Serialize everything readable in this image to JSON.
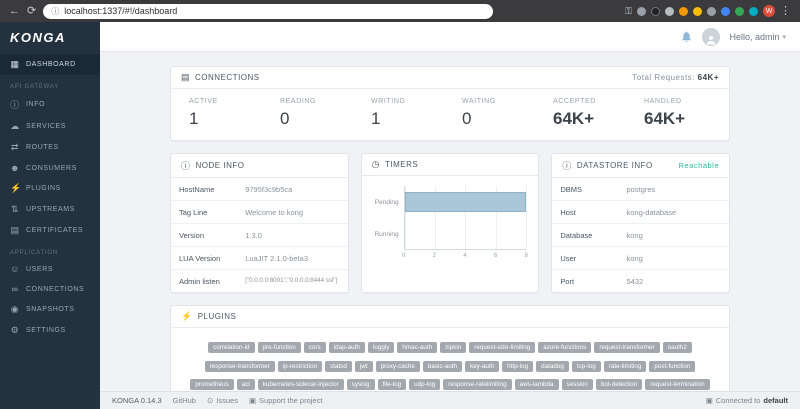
{
  "browser": {
    "url": "localhost:1337/#!/dashboard",
    "profile_initial": "W"
  },
  "icons": {
    "back": "←",
    "forward": "→",
    "reload": "⟳",
    "url_info": "ⓘ",
    "menu": "⋮",
    "grid": "▦",
    "info": "ⓘ",
    "cloud": "☁",
    "routes": "⇄",
    "consumers": "☻",
    "plug": "⚡",
    "upstreams": "⇅",
    "certificates": "▤",
    "user": "☺",
    "link": "∞",
    "camera": "◉",
    "gear": "⚙",
    "clock": "◷",
    "server": "▤",
    "caret": "▾",
    "issues": "⊙",
    "monitor": "▣"
  },
  "sidebar": {
    "logo": "KONGA",
    "sections": {
      "gateway": "API GATEWAY",
      "application": "APPLICATION"
    },
    "items": [
      {
        "label": "DASHBOARD"
      },
      {
        "label": "INFO"
      },
      {
        "label": "SERVICES"
      },
      {
        "label": "ROUTES"
      },
      {
        "label": "CONSUMERS"
      },
      {
        "label": "PLUGINS"
      },
      {
        "label": "UPSTREAMS"
      },
      {
        "label": "CERTIFICATES"
      },
      {
        "label": "USERS"
      },
      {
        "label": "CONNECTIONS"
      },
      {
        "label": "SNAPSHOTS"
      },
      {
        "label": "SETTINGS"
      }
    ]
  },
  "topbar": {
    "greeting": "Hello, admin"
  },
  "connections": {
    "title": "CONNECTIONS",
    "total_label": "Total Requests:",
    "total_value": "64K+",
    "stats": [
      {
        "label": "ACTIVE",
        "value": "1"
      },
      {
        "label": "READING",
        "value": "0"
      },
      {
        "label": "WRITING",
        "value": "1"
      },
      {
        "label": "WAITING",
        "value": "0"
      },
      {
        "label": "ACCEPTED",
        "value": "64K+"
      },
      {
        "label": "HANDLED",
        "value": "64K+"
      }
    ]
  },
  "node_info": {
    "title": "NODE INFO",
    "rows": [
      {
        "label": "HostName",
        "value": "9795f3c9b5ca"
      },
      {
        "label": "Tag Line",
        "value": "Welcome to kong"
      },
      {
        "label": "Version",
        "value": "1.3.0"
      },
      {
        "label": "LUA Version",
        "value": "LuaJIT 2.1.0-beta3"
      },
      {
        "label": "Admin listen",
        "value": "[\"0.0.0.0:8001\",\"0.0.0.0:8444 ssl\"]"
      }
    ]
  },
  "timers": {
    "title": "TIMERS",
    "chart_data": {
      "type": "bar",
      "orientation": "horizontal",
      "categories": [
        "Pending",
        "Running"
      ],
      "values": [
        8,
        0
      ],
      "xlim": [
        0,
        8
      ],
      "xticks": [
        0,
        2,
        4,
        6,
        8
      ],
      "bar_color": "#a9c7d9",
      "grid": true
    }
  },
  "datastore": {
    "title": "DATASTORE INFO",
    "badge": "Reachable",
    "badge_color": "#2cb5a0",
    "rows": [
      {
        "label": "DBMS",
        "value": "postgres"
      },
      {
        "label": "Host",
        "value": "kong-database"
      },
      {
        "label": "Database",
        "value": "kong"
      },
      {
        "label": "User",
        "value": "kong"
      },
      {
        "label": "Port",
        "value": "5432"
      }
    ]
  },
  "plugins": {
    "title": "PLUGINS",
    "tags": [
      "correlation-id",
      "pre-function",
      "cors",
      "ldap-auth",
      "loggly",
      "hmac-auth",
      "zipkin",
      "request-size-limiting",
      "azure-functions",
      "request-transformer",
      "oauth2",
      "response-transformer",
      "ip-restriction",
      "statsd",
      "jwt",
      "proxy-cache",
      "basic-auth",
      "key-auth",
      "http-log",
      "datadog",
      "tcp-log",
      "rate-limiting",
      "post-function",
      "prometheus",
      "acl",
      "kubernetes-sidecar-injector",
      "syslog",
      "file-log",
      "udp-log",
      "response-ratelimiting",
      "aws-lambda",
      "session",
      "bot-detection",
      "request-termination"
    ]
  },
  "footer": {
    "version": "KONGA 0.14.3",
    "github": "GitHub",
    "issues": "Issues",
    "support": "Support the project",
    "connected_label": "Connected to",
    "connected_value": "default"
  }
}
